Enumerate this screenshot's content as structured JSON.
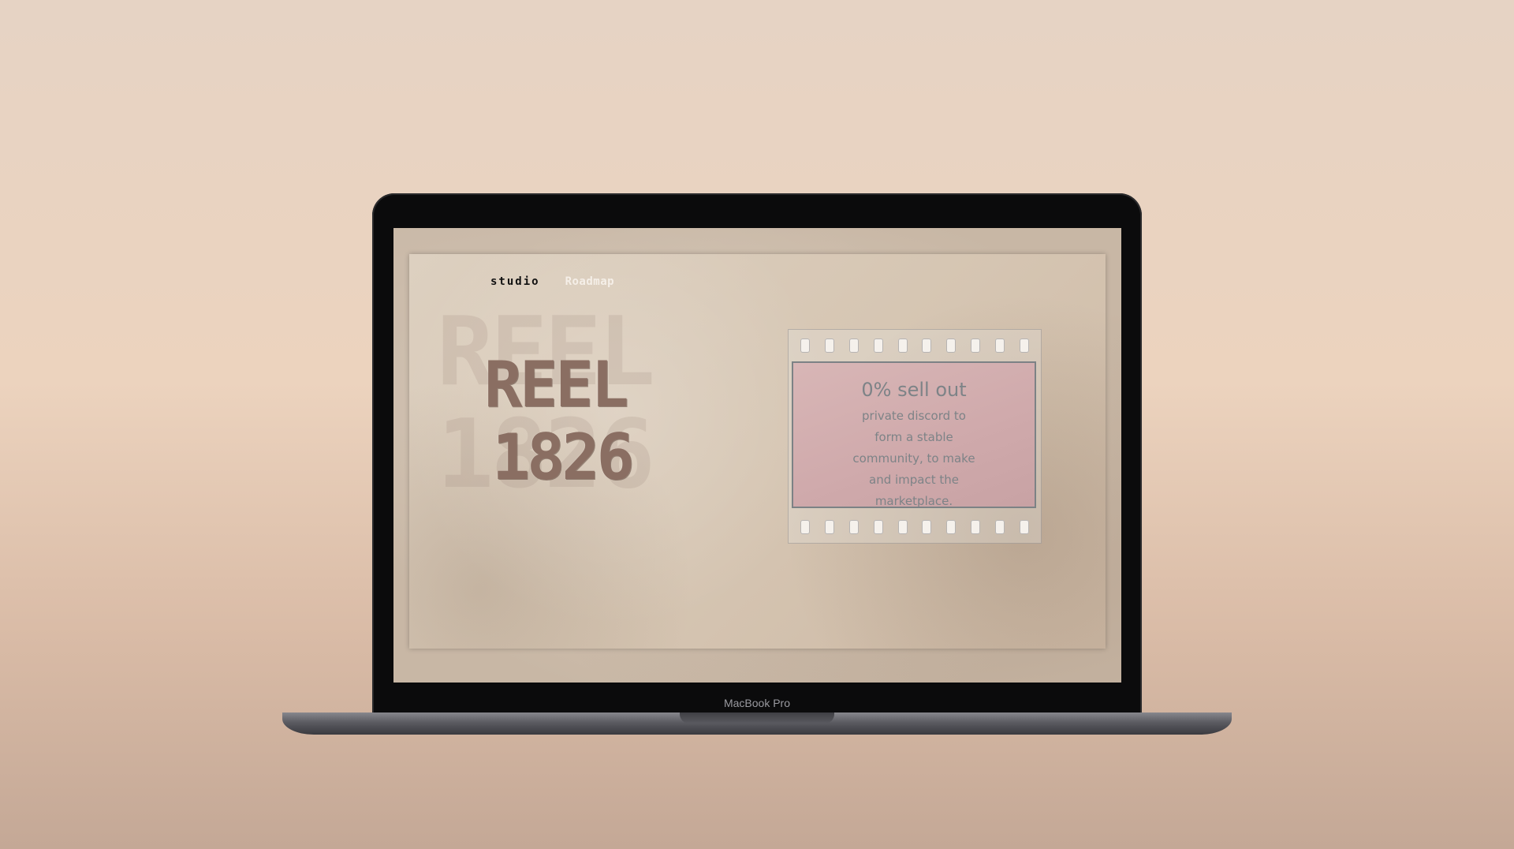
{
  "device": {
    "label": "MacBook Pro"
  },
  "nav": {
    "studio_label": "studio",
    "roadmap_label": "Roadmap"
  },
  "hero": {
    "line1": "REEL",
    "line2": "1826"
  },
  "card": {
    "title": "0% sell out",
    "text": "private discord to form a stable community, to make and impact the marketplace."
  },
  "colors": {
    "background_top": "#e6d3c4",
    "background_bottom": "#c4a896",
    "brand_text": "#8a6e62",
    "card_fill": "#d8b6b6",
    "card_text": "#7d8387"
  }
}
